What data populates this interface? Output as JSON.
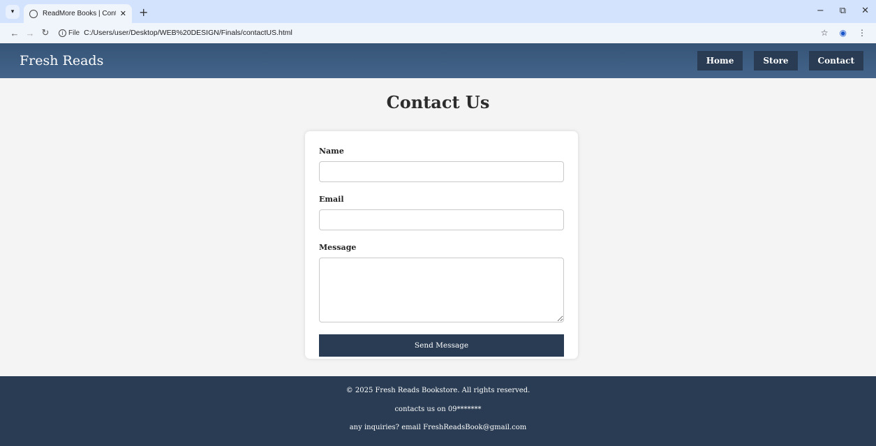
{
  "browser": {
    "tab_title": "ReadMore Books | Contact Us",
    "tab_close": "✕",
    "new_tab": "+",
    "file_label": "File",
    "url": "C:/Users/user/Desktop/WEB%20DESIGN/Finals/contactUS.html",
    "window_controls": [
      "−",
      "⧉",
      "✕"
    ]
  },
  "header": {
    "brand": "Fresh Reads",
    "nav": [
      "Home",
      "Store",
      "Contact"
    ]
  },
  "main": {
    "title": "Contact Us",
    "form": {
      "name_label": "Name",
      "name_value": "",
      "email_label": "Email",
      "email_value": "",
      "message_label": "Message",
      "message_value": "",
      "submit_label": "Send Message"
    }
  },
  "footer": {
    "copyright": "© 2025 Fresh Reads Bookstore. All rights reserved.",
    "contact": "contacts us on 09*******",
    "inquiries": "any inquiries? email FreshReadsBook@gmail.com"
  },
  "colors": {
    "header_bg": "#3f5e84",
    "nav_button_bg": "#293c53",
    "footer_bg": "#293c53",
    "page_bg": "#f4f4f4"
  }
}
